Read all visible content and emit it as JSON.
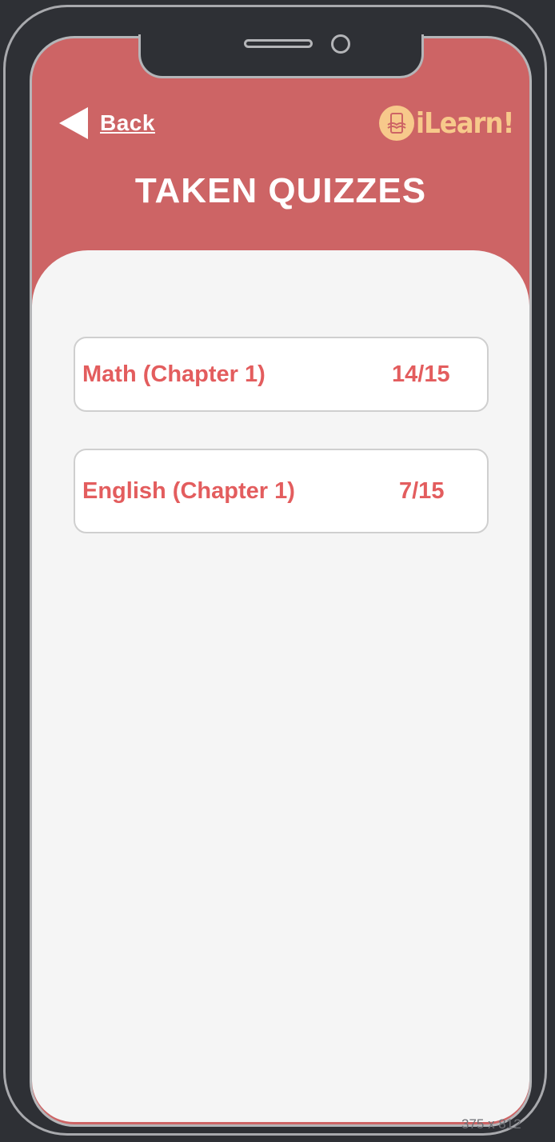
{
  "header": {
    "back_label": "Back",
    "logo_text": "iLearn!",
    "title": "TAKEN QUIZZES"
  },
  "quizzes": [
    {
      "name": "Math (Chapter 1)",
      "score": "14/15"
    },
    {
      "name": "English (Chapter 1)",
      "score": "7/15"
    }
  ],
  "frame": {
    "dimensions_label": "375 x 812"
  },
  "colors": {
    "header_bg": "#cd6465",
    "accent_text": "#e35d5e",
    "logo": "#f7c98b",
    "panel_bg": "#f5f5f5"
  },
  "icons": {
    "back": "triangle-left-icon",
    "logo": "phone-book-icon"
  }
}
